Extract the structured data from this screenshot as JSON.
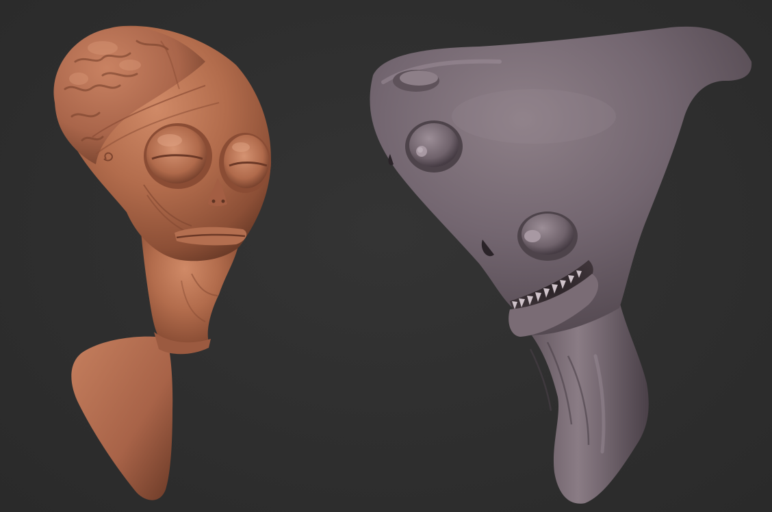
{
  "scene": {
    "background_color": "#2e2e2e",
    "objects": [
      {
        "name": "alien-head-sculpt",
        "material_color": "#b0694a"
      },
      {
        "name": "shark-creature-sculpt",
        "material_color": "#6e6168"
      }
    ]
  }
}
